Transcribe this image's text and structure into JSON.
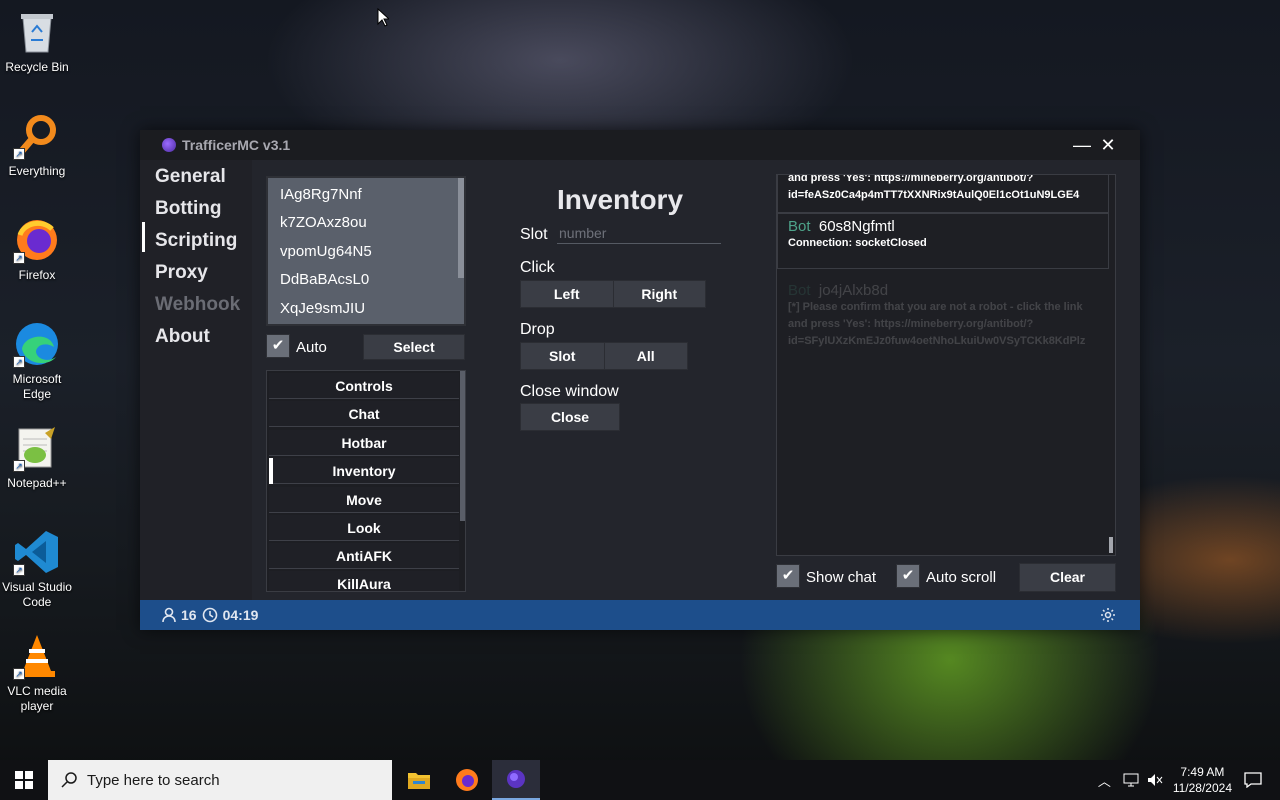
{
  "desktop": {
    "icons": [
      {
        "label": "Recycle Bin",
        "icon": "recycle-bin-icon"
      },
      {
        "label": "Everything",
        "icon": "everything-search-icon"
      },
      {
        "label": "Firefox",
        "icon": "firefox-icon"
      },
      {
        "label": "Microsoft Edge",
        "icon": "edge-icon"
      },
      {
        "label": "Notepad++",
        "icon": "notepadpp-icon"
      },
      {
        "label": "Visual Studio Code",
        "icon": "vscode-icon"
      },
      {
        "label": "VLC media player",
        "icon": "vlc-icon"
      }
    ]
  },
  "app": {
    "title": "TrafficerMC v3.1",
    "minimize_glyph": "—",
    "close_glyph": "✕",
    "nav": [
      {
        "label": "General",
        "enabled": true
      },
      {
        "label": "Botting",
        "enabled": true,
        "selected": true
      },
      {
        "label": "Scripting",
        "enabled": true
      },
      {
        "label": "Proxy",
        "enabled": true
      },
      {
        "label": "Webhook",
        "enabled": false
      },
      {
        "label": "About",
        "enabled": true
      }
    ],
    "bots": [
      "IAg8Rg7Nnf",
      "k7ZOAxz8ou",
      "vpomUg64N5",
      "DdBaBAcsL0",
      "XqJe9smJIU"
    ],
    "auto_label": "Auto",
    "auto_checked": true,
    "select_label": "Select",
    "commands": [
      "Controls",
      "Chat",
      "Hotbar",
      "Inventory",
      "Move",
      "Look",
      "AntiAFK",
      "KillAura"
    ],
    "selected_command": "Inventory",
    "inventory": {
      "title": "Inventory",
      "slot_label": "Slot",
      "slot_placeholder": "number",
      "click_label": "Click",
      "left_label": "Left",
      "right_label": "Right",
      "drop_label": "Drop",
      "drop_slot_label": "Slot",
      "drop_all_label": "All",
      "close_window_label": "Close window",
      "close_label": "Close"
    },
    "console": {
      "messages": [
        {
          "bot_prefix": "",
          "bot": "",
          "text": "and press 'Yes': https://mineberry.org/antibot/?id=feASz0Ca4p4mTT7tXXNRix9tAulQ0El1cOt1uN9LGE4"
        },
        {
          "bot_prefix": "Bot",
          "bot": "60s8Ngfmtl",
          "text": "Connection: socketClosed"
        },
        {
          "bot_prefix": "Bot",
          "bot": "jo4jAlxb8d",
          "text": "[*] Please confirm that you are not a robot - click the link and press 'Yes': https://mineberry.org/antibot/?id=SFylUXzKmEJz0fuw4oetNhoLkuiUw0VSyTCKk8KdPlz"
        }
      ],
      "show_chat_label": "Show chat",
      "show_chat_checked": true,
      "auto_scroll_label": "Auto scroll",
      "auto_scroll_checked": true,
      "clear_label": "Clear"
    },
    "status": {
      "bot_count": "16",
      "uptime": "04:19"
    }
  },
  "taskbar": {
    "search_placeholder": "Type here to search",
    "time": "7:49 AM",
    "date": "11/28/2024"
  },
  "colors": {
    "status_bar": "#1d4e8b",
    "bot_name_accent": "#4ea38a",
    "window_bg": "#23252c"
  }
}
